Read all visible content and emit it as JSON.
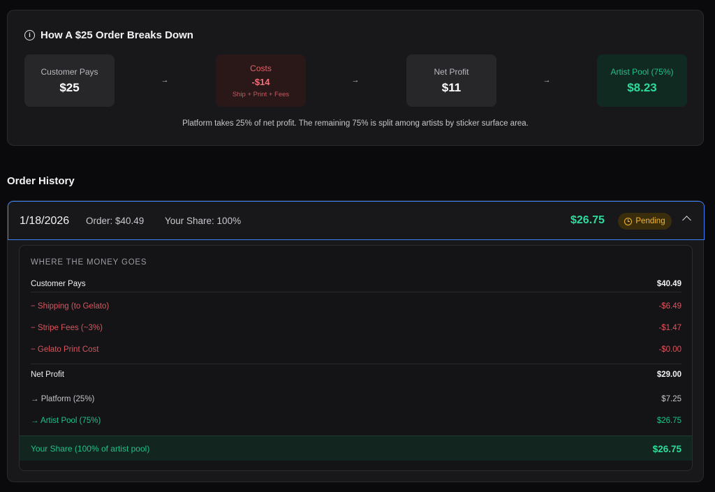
{
  "breakdown": {
    "title": "How A $25 Order Breaks Down",
    "info_icon": "i",
    "boxes": [
      {
        "label": "Customer Pays",
        "value": "$25"
      },
      {
        "label": "Costs",
        "value": "-$14",
        "sub": "Ship + Print + Fees"
      },
      {
        "label": "Net Profit",
        "value": "$11"
      },
      {
        "label": "Artist Pool (75%)",
        "value": "$8.23"
      }
    ],
    "arrow": "→",
    "note": "Platform takes 25% of net profit. The remaining 75% is split among artists by sticker surface area."
  },
  "order_history": {
    "title": "Order History",
    "order": {
      "date": "1/18/2026",
      "order_total": "Order: $40.49",
      "your_share": "Your Share: 100%",
      "amount": "$26.75",
      "status": "Pending"
    },
    "money": {
      "heading": "WHERE THE MONEY GOES",
      "customer_pays": {
        "label": "Customer Pays",
        "value": "$40.49"
      },
      "costs": [
        {
          "label": "− Shipping (to Gelato)",
          "value": "-$6.49"
        },
        {
          "label": "− Stripe Fees (~3%)",
          "value": "-$1.47"
        },
        {
          "label": "− Gelato Print Cost",
          "value": "-$0.00"
        }
      ],
      "net_profit": {
        "label": "Net Profit",
        "value": "$29.00"
      },
      "platform": {
        "label": "→ Platform (25%)",
        "value": "$7.25"
      },
      "artist_pool": {
        "label": "→ Artist Pool (75%)",
        "value": "$26.75"
      },
      "your_share": {
        "label": "Your Share (100% of artist pool)",
        "value": "$26.75"
      }
    }
  },
  "colors": {
    "accent_green": "#2ddc9c",
    "cost_red": "#d8565f",
    "pending_amber": "#f5b82e",
    "focus_blue": "#3b82f6"
  }
}
